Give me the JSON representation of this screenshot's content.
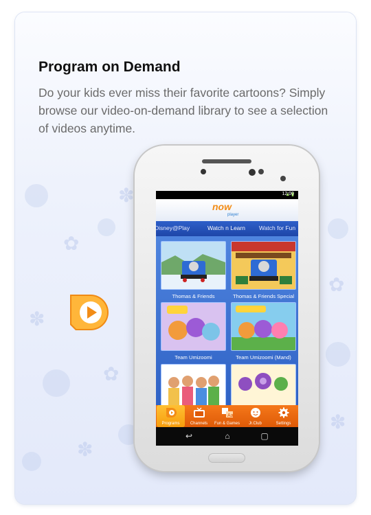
{
  "heading": "Program on Demand",
  "description": "Do your kids ever miss their favorite cartoons? Simply browse our video-on-demand library to see a selection of videos anytime.",
  "status": {
    "time": "12:00"
  },
  "app": {
    "logo_main": "now",
    "logo_sub": "player"
  },
  "tabs": [
    {
      "label": "Disney@Play",
      "active": false
    },
    {
      "label": "Watch n Learn",
      "active": true
    },
    {
      "label": "Watch for Fun",
      "active": false
    }
  ],
  "tiles": [
    {
      "label": "Thomas & Friends"
    },
    {
      "label": "Thomas & Friends Special"
    },
    {
      "label": "Team Umizoomi"
    },
    {
      "label": "Team Umizoomi (Mand)"
    },
    {
      "label": ""
    },
    {
      "label": ""
    }
  ],
  "nav": [
    {
      "label": "Programs",
      "icon": "play-icon",
      "active": true
    },
    {
      "label": "Channels",
      "icon": "tv-icon",
      "active": false
    },
    {
      "label": "Fun & Games",
      "icon": "games-icon",
      "active": false
    },
    {
      "label": "Jr.Club",
      "icon": "face-icon",
      "active": false
    },
    {
      "label": "Settings",
      "icon": "gear-icon",
      "active": false
    }
  ],
  "colors": {
    "accent_orange": "#f5781a",
    "tab_blue": "#2e5fc9",
    "grid_blue": "#3f72d2"
  }
}
